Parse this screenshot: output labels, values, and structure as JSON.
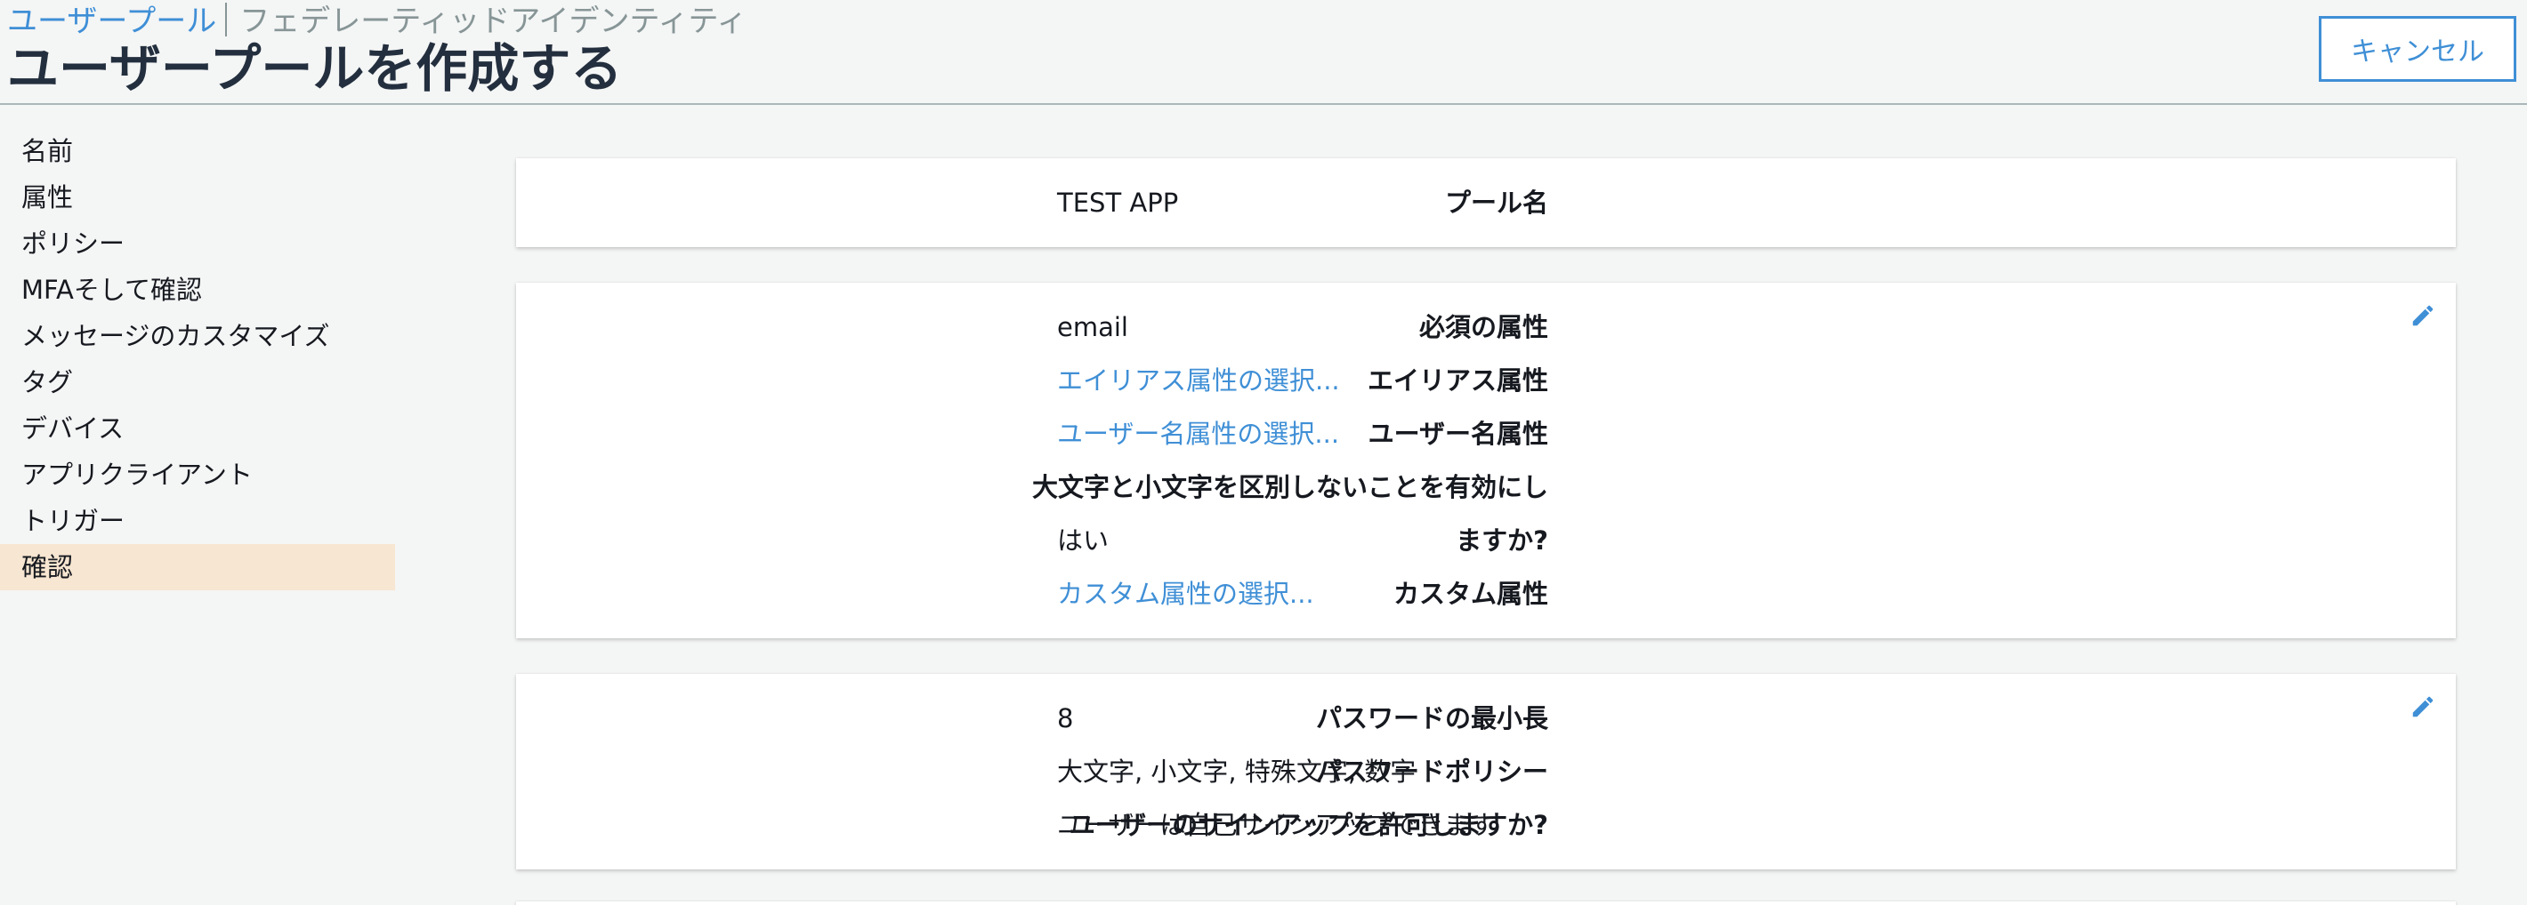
{
  "breadcrumb": {
    "user_pools": "ユーザープール",
    "federated_identities": "フェデレーティッドアイデンティティ"
  },
  "page_title": "ユーザープールを作成する",
  "cancel_label": "キャンセル",
  "sidebar": {
    "items": [
      {
        "label": "名前"
      },
      {
        "label": "属性"
      },
      {
        "label": "ポリシー"
      },
      {
        "label": "MFAそして確認"
      },
      {
        "label": "メッセージのカスタマイズ"
      },
      {
        "label": "タグ"
      },
      {
        "label": "デバイス"
      },
      {
        "label": "アプリクライアント"
      },
      {
        "label": "トリガー"
      },
      {
        "label": "確認"
      }
    ],
    "active_index": 9
  },
  "pool_name": {
    "label": "プール名",
    "value": "TEST APP"
  },
  "attributes": {
    "required_label": "必須の属性",
    "required_value": "email",
    "alias_label": "エイリアス属性",
    "alias_value": "エイリアス属性の選択...",
    "username_label": "ユーザー名属性",
    "username_value": "ユーザー名属性の選択...",
    "case_label_line1": "大文字と小文字を区別しないことを有効にし",
    "case_label_line2": "ますか?",
    "case_value": "はい",
    "custom_label": "カスタム属性",
    "custom_value": "カスタム属性の選択..."
  },
  "policies": {
    "min_length_label": "パスワードの最小長",
    "min_length_value": "8",
    "policy_label": "パスワードポリシー",
    "policy_value": "大文字, 小文字, 特殊文字, 数字",
    "signup_label": "ユーザーのサインアップを許可しますか?",
    "signup_value": "ユーザーは自己サインアップできます"
  },
  "colors": {
    "link": "#3f8fd6",
    "active_nav_bg": "#f7e6d1",
    "page_bg": "#f4f5f5"
  },
  "icons": {
    "edit": "pencil-icon"
  }
}
